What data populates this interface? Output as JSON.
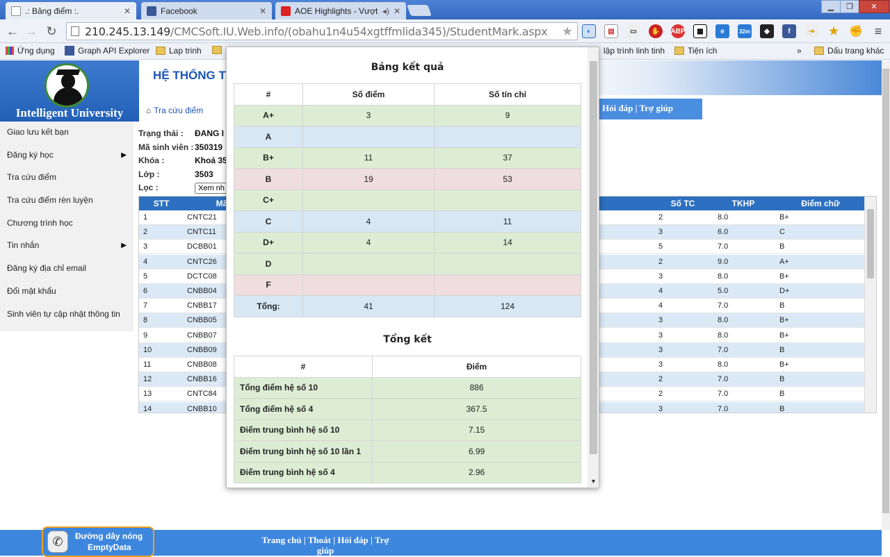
{
  "browser": {
    "tabs": [
      {
        "title": ".: Bảng điểm :.",
        "active": true,
        "favicon": "page-icon"
      },
      {
        "title": "Facebook",
        "active": false,
        "favicon": "facebook-icon"
      },
      {
        "title": "AOE Highlights - Vượt",
        "active": false,
        "favicon": "youtube-icon"
      }
    ],
    "url_host": "210.245.13.149",
    "url_path": "/CMCSoft.IU.Web.info/(obahu1n4u54xgtffmlida345)/StudentMark.aspx",
    "bookmarks": [
      {
        "label": "Ứng dụng",
        "icon": "apps-icon"
      },
      {
        "label": "Graph API Explorer",
        "icon": "facebook-icon"
      },
      {
        "label": "Lap trinh",
        "icon": "folder-icon"
      },
      {
        "label": "lập trình linh tinh",
        "icon": "folder-icon"
      },
      {
        "label": "Tiện ích",
        "icon": "folder-icon"
      },
      {
        "label": "Dấu trang khác",
        "icon": "folder-icon"
      }
    ],
    "bookmarks_more": "»",
    "extension_badge": "32m"
  },
  "site": {
    "logo_text": "Intelligent University",
    "title": "HỆ THỐNG TH",
    "breadcrumb": "Tra cứu điểm",
    "help_links": "Hỏi đáp | Trợ giúp"
  },
  "sidebar": {
    "items": [
      {
        "label": "Giao lưu kết bạn",
        "has_submenu": false
      },
      {
        "label": "Đăng ký học",
        "has_submenu": true
      },
      {
        "label": "Tra cứu điểm",
        "has_submenu": false
      },
      {
        "label": "Tra cứu điểm rèn luyện",
        "has_submenu": false
      },
      {
        "label": "Chương trình học",
        "has_submenu": false
      },
      {
        "label": "Tin nhắn",
        "has_submenu": true
      },
      {
        "label": "Đăng ký địa chỉ email",
        "has_submenu": false
      },
      {
        "label": "Đổi mật khẩu",
        "has_submenu": false
      },
      {
        "label": "Sinh viên tự cập nhật thông tin",
        "has_submenu": false
      }
    ]
  },
  "student": {
    "status_label": "Trạng thái :",
    "status_value": "ĐANG I",
    "id_label": "Mã sinh viên :",
    "id_value": "350319",
    "course_label": "Khóa :",
    "course_value": "Khoá 35",
    "class_label": "Lớp :",
    "class_value": "3503",
    "filter_label": "Lọc :",
    "filter_value": "Xem nhi"
  },
  "grid": {
    "headers": {
      "stt": "STT",
      "code": "Mã",
      "credits": "Số TC",
      "score": "TKHP",
      "letter": "Điểm chữ"
    },
    "rows": [
      {
        "stt": "1",
        "code": "CNTC21",
        "credits": "2",
        "score": "8.0",
        "letter": "B+"
      },
      {
        "stt": "2",
        "code": "CNTC11",
        "credits": "3",
        "score": "6.0",
        "letter": "C"
      },
      {
        "stt": "3",
        "code": "DCBB01",
        "credits": "5",
        "score": "7.0",
        "letter": "B"
      },
      {
        "stt": "4",
        "code": "CNTC26",
        "credits": "2",
        "score": "9.0",
        "letter": "A+"
      },
      {
        "stt": "5",
        "code": "DCTC08",
        "credits": "3",
        "score": "8.0",
        "letter": "B+"
      },
      {
        "stt": "6",
        "code": "CNBB04",
        "credits": "4",
        "score": "5.0",
        "letter": "D+"
      },
      {
        "stt": "7",
        "code": "CNBB17",
        "credits": "4",
        "score": "7.0",
        "letter": "B"
      },
      {
        "stt": "8",
        "code": "CNBB05",
        "credits": "3",
        "score": "8.0",
        "letter": "B+"
      },
      {
        "stt": "9",
        "code": "CNBB07",
        "credits": "3",
        "score": "8.0",
        "letter": "B+"
      },
      {
        "stt": "10",
        "code": "CNBB09",
        "credits": "3",
        "score": "7.0",
        "letter": "B"
      },
      {
        "stt": "11",
        "code": "CNBB08",
        "credits": "3",
        "score": "8.0",
        "letter": "B+"
      },
      {
        "stt": "12",
        "code": "CNBB16",
        "credits": "2",
        "score": "7.0",
        "letter": "B"
      },
      {
        "stt": "13",
        "code": "CNTC84",
        "credits": "2",
        "score": "7.0",
        "letter": "B"
      },
      {
        "stt": "14",
        "code": "CNBB10",
        "credits": "3",
        "score": "7.0",
        "letter": "B"
      }
    ]
  },
  "modal": {
    "results_title": "Bảng kết quả",
    "results_headers": {
      "grade": "#",
      "count": "Số điểm",
      "credits": "Số tín chỉ"
    },
    "results_rows": [
      {
        "grade": "A+",
        "count": "3",
        "credits": "9",
        "tone": "g"
      },
      {
        "grade": "A",
        "count": "",
        "credits": "",
        "tone": "b"
      },
      {
        "grade": "B+",
        "count": "11",
        "credits": "37",
        "tone": "g"
      },
      {
        "grade": "B",
        "count": "19",
        "credits": "53",
        "tone": "r"
      },
      {
        "grade": "C+",
        "count": "",
        "credits": "",
        "tone": "g"
      },
      {
        "grade": "C",
        "count": "4",
        "credits": "11",
        "tone": "b"
      },
      {
        "grade": "D+",
        "count": "4",
        "credits": "14",
        "tone": "g"
      },
      {
        "grade": "D",
        "count": "",
        "credits": "",
        "tone": "g"
      },
      {
        "grade": "F",
        "count": "",
        "credits": "",
        "tone": "r"
      },
      {
        "grade": "Tổng:",
        "count": "41",
        "credits": "124",
        "tone": "b"
      }
    ],
    "summary_title": "Tổng kết",
    "summary_headers": {
      "label": "#",
      "value": "Điểm"
    },
    "summary_rows": [
      {
        "label": "Tổng điểm hệ số 10",
        "value": "886"
      },
      {
        "label": "Tổng điểm hệ số 4",
        "value": "367.5"
      },
      {
        "label": "Điểm trung bình hệ số 10",
        "value": "7.15"
      },
      {
        "label": "Điểm trung bình hệ số 10 lần 1",
        "value": "6.99"
      },
      {
        "label": "Điểm trung bình hệ số 4",
        "value": "2.96"
      }
    ]
  },
  "footer": {
    "hotline_label": "Đường dây nóng",
    "hotline_value": "EmptyData",
    "links": "Trang chủ | Thoát | Hỏi đáp | Trợ giúp"
  },
  "colors": {
    "accent_blue": "#2d6fc0",
    "row_green": "#dcedd4",
    "row_blue": "#d7e7f4",
    "row_red": "#f0dde0"
  }
}
